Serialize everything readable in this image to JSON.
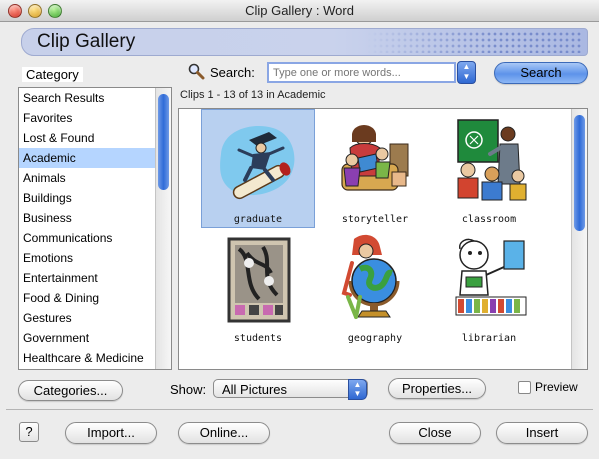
{
  "window": {
    "title": "Clip Gallery : Word"
  },
  "banner": {
    "title": "Clip Gallery"
  },
  "category": {
    "label": "Category",
    "items": [
      {
        "label": "Search Results"
      },
      {
        "label": "Favorites"
      },
      {
        "label": "Lost & Found"
      },
      {
        "label": "Academic",
        "selected": true
      },
      {
        "label": "Animals"
      },
      {
        "label": "Buildings"
      },
      {
        "label": "Business"
      },
      {
        "label": "Communications"
      },
      {
        "label": "Emotions"
      },
      {
        "label": "Entertainment"
      },
      {
        "label": "Food & Dining"
      },
      {
        "label": "Gestures"
      },
      {
        "label": "Government"
      },
      {
        "label": "Healthcare & Medicine"
      }
    ]
  },
  "search": {
    "label": "Search:",
    "placeholder": "Type one or more words...",
    "button_label": "Search",
    "icon": "magnifier-icon"
  },
  "clips": {
    "info": "Clips 1 - 13 of 13 in Academic",
    "items": [
      {
        "caption": "graduate",
        "icon": "graduate-icon",
        "selected": true
      },
      {
        "caption": "storyteller",
        "icon": "storyteller-icon"
      },
      {
        "caption": "classroom",
        "icon": "classroom-icon"
      },
      {
        "caption": "students",
        "icon": "students-icon"
      },
      {
        "caption": "geography",
        "icon": "geography-icon"
      },
      {
        "caption": "librarian",
        "icon": "librarian-icon"
      }
    ]
  },
  "controls": {
    "categories_button": "Categories...",
    "show_label": "Show:",
    "show_value": "All Pictures",
    "properties_button": "Properties...",
    "preview_label": "Preview",
    "preview_checked": false
  },
  "footer": {
    "help_label": "?",
    "import_button": "Import...",
    "online_button": "Online...",
    "close_button": "Close",
    "insert_button": "Insert"
  },
  "colors": {
    "accent": "#3f7be3",
    "selection": "#b5d5ff",
    "banner": "#c7d0ea"
  }
}
